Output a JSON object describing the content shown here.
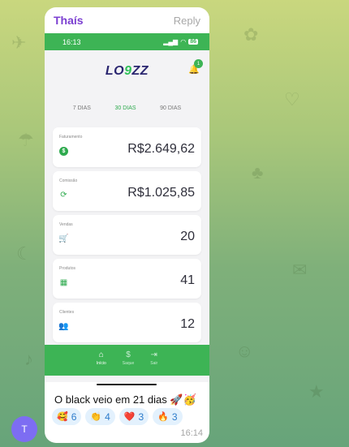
{
  "chat": {
    "sender": "Thaís",
    "reply_label": "Reply",
    "avatar_initial": "T",
    "caption": "O black veio em 21 dias 🚀🥳",
    "time": "16:14",
    "reactions": [
      {
        "emoji": "🥰",
        "count": "6"
      },
      {
        "emoji": "👏",
        "count": "4"
      },
      {
        "emoji": "❤️",
        "count": "3"
      },
      {
        "emoji": "🔥",
        "count": "3"
      }
    ]
  },
  "phone": {
    "status_time": "16:13",
    "battery": "86",
    "logo_left": "LO",
    "logo_mid": "9",
    "logo_right": "ZZ",
    "notification_count": "1",
    "periods": [
      "7 DIAS",
      "30 DIAS",
      "90 DIAS"
    ],
    "active_period": "30 DIAS",
    "cards": [
      {
        "label": "Faturamento",
        "value": "R$2.649,62",
        "icon": "dollar-icon"
      },
      {
        "label": "Comissão",
        "value": "R$1.025,85",
        "icon": "refresh-dollar-icon"
      },
      {
        "label": "Vendas",
        "value": "20",
        "icon": "cart-icon"
      },
      {
        "label": "Produtos",
        "value": "41",
        "icon": "grid-icon"
      },
      {
        "label": "Clientes",
        "value": "12",
        "icon": "users-icon"
      }
    ],
    "nav": [
      {
        "label": "Início",
        "icon": "home-icon"
      },
      {
        "label": "Saque",
        "icon": "dollar-icon"
      },
      {
        "label": "Sair",
        "icon": "logout-icon"
      }
    ]
  }
}
